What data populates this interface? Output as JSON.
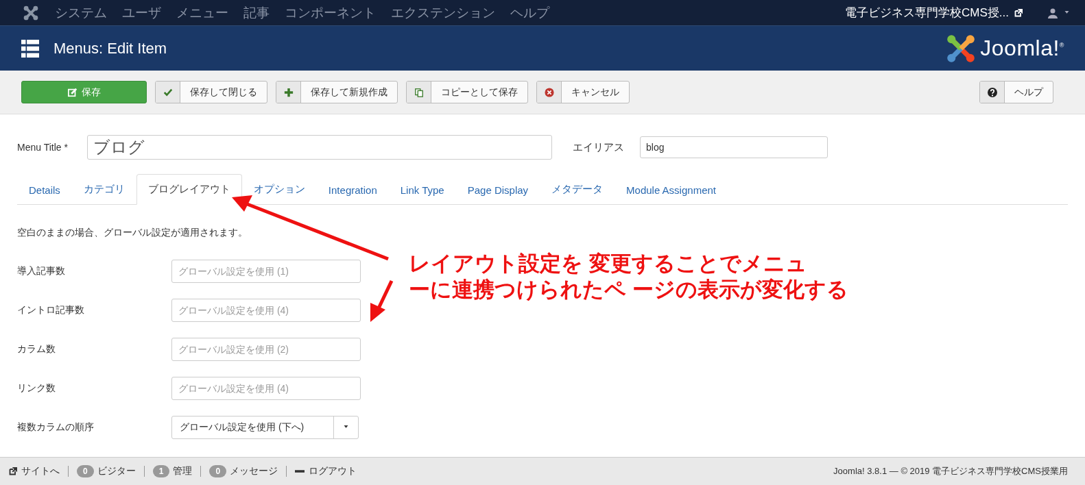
{
  "top_menu": {
    "items": [
      "システム",
      "ユーザ",
      "メニュー",
      "記事",
      "コンポーネント",
      "エクステンション",
      "ヘルプ"
    ],
    "site_link": "電子ビジネス専門学校CMS授..."
  },
  "header": {
    "title": "Menus: Edit Item",
    "logo_text": "Joomla!$^{®}$"
  },
  "toolbar": {
    "buttons": [
      {
        "label": "保存",
        "kind": "primary"
      },
      {
        "label": "保存して閉じる",
        "kind": "default"
      },
      {
        "label": "保存して新規作成",
        "kind": "default"
      },
      {
        "label": "コピーとして保存",
        "kind": "default"
      },
      {
        "label": "キャンセル",
        "kind": "default"
      }
    ],
    "help_button": {
      "label": "ヘルプ"
    }
  },
  "title_field": {
    "label": "Menu Title *",
    "value": "ブログ"
  },
  "alias_field": {
    "label": "エイリアス",
    "value": "blog"
  },
  "tabs": [
    {
      "label": "Details",
      "selected": false
    },
    {
      "label": "カテゴリ",
      "selected": false
    },
    {
      "label": "ブログレイアウト",
      "selected": true
    },
    {
      "label": "オプション",
      "selected": false
    },
    {
      "label": "Integration",
      "selected": false
    },
    {
      "label": "Link Type",
      "selected": false
    },
    {
      "label": "Page Display",
      "selected": false
    },
    {
      "label": "メタデータ",
      "selected": false
    },
    {
      "label": "Module Assignment",
      "selected": false
    }
  ],
  "info_text": "空白のままの場合、グローバル設定が適用されます。",
  "fields": [
    {
      "label": "導入記事数",
      "kind": "text",
      "placeholder": "グローバル設定を使用 (1)"
    },
    {
      "label": "イントロ記事数",
      "kind": "text",
      "placeholder": "グローバル設定を使用 (4)"
    },
    {
      "label": "カラム数",
      "kind": "text",
      "placeholder": "グローバル設定を使用 (2)"
    },
    {
      "label": "リンク数",
      "kind": "text",
      "placeholder": "グローバル設定を使用 (4)"
    },
    {
      "label": "複数カラムの順序",
      "kind": "select",
      "value": "グローバル設定を使用 (下へ)"
    }
  ],
  "annotation": {
    "lines": [
      "レイアウト設定を 変更することでメニュ",
      "ーに連携つけられたペ ージの表示が変化する"
    ]
  },
  "status_bar": {
    "site_link": "サイトへ",
    "items": [
      {
        "count": "0",
        "label": "ビジター"
      },
      {
        "count": "1",
        "label": "管理"
      },
      {
        "count": "0",
        "label": "メッセージ"
      }
    ],
    "logout": "ログアウト",
    "footer": "Joomla! 3.8.1 — © 2019 電子ビジネス専門学校CMS授業用"
  }
}
